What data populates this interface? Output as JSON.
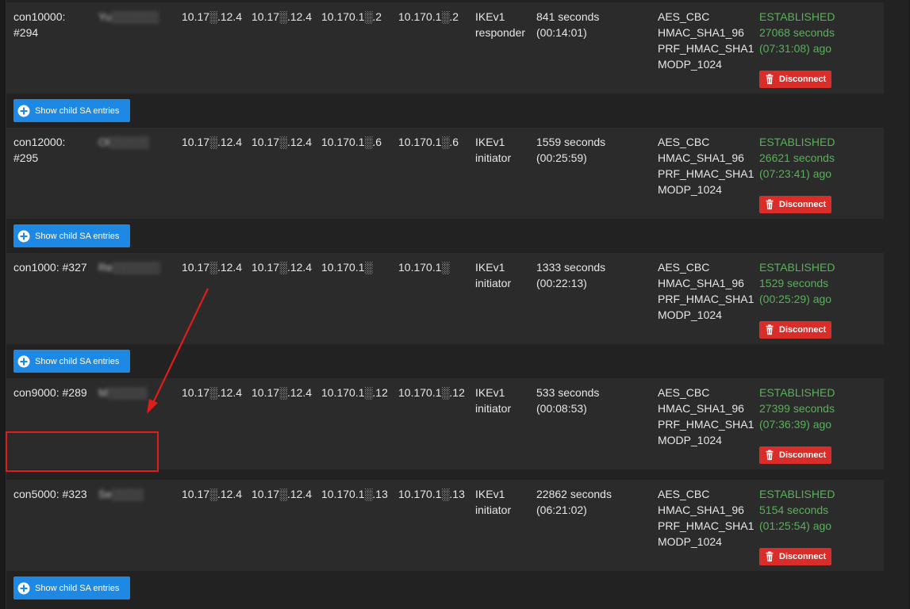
{
  "labels": {
    "disconnect": "Disconnect",
    "show_child": "Show child SA entries"
  },
  "colors": {
    "established": "#58b158",
    "disconnect_bg": "#d92d2a",
    "child_button_bg": "#1e88e5",
    "annotation": "#e21b1b"
  },
  "icons": {
    "disconnect": "trash-icon",
    "show_child": "plus-circle-icon"
  },
  "rows": [
    {
      "id_line1": "con10000:",
      "id_line2": "#294",
      "description": "Yu░░░░░░",
      "local_id": "10.17░.12.4",
      "remote_id": "10.17░.12.4",
      "local_ip": "10.170.1░.2",
      "remote_ip": "10.170.1░.2",
      "ike_line1": "IKEv1",
      "ike_line2": "responder",
      "life_line1": "841 seconds",
      "life_line2": "(00:14:01)",
      "algo": [
        "AES_CBC",
        "HMAC_SHA1_96",
        "PRF_HMAC_SHA1",
        "MODP_1024"
      ],
      "status_line1": "ESTABLISHED",
      "status_line2": "27068 seconds",
      "status_line3": "(07:31:08) ago"
    },
    {
      "id_line1": "con12000:",
      "id_line2": "#295",
      "description": "Ol░░░░░",
      "local_id": "10.17░.12.4",
      "remote_id": "10.17░.12.4",
      "local_ip": "10.170.1░.6",
      "remote_ip": "10.170.1░.6",
      "ike_line1": "IKEv1",
      "ike_line2": "initiator",
      "life_line1": "1559 seconds",
      "life_line2": "(00:25:59)",
      "algo": [
        "AES_CBC",
        "HMAC_SHA1_96",
        "PRF_HMAC_SHA1",
        "MODP_1024"
      ],
      "status_line1": "ESTABLISHED",
      "status_line2": "26621 seconds",
      "status_line3": "(07:23:41) ago"
    },
    {
      "id_line1": "con1000: #327",
      "id_line2": "",
      "description": "Re░░░░░░",
      "local_id": "10.17░.12.4",
      "remote_id": "10.17░.12.4",
      "local_ip": "10.170.1░",
      "remote_ip": "10.170.1░",
      "ike_line1": "IKEv1",
      "ike_line2": "initiator",
      "life_line1": "1333 seconds",
      "life_line2": "(00:22:13)",
      "algo": [
        "AES_CBC",
        "HMAC_SHA1_96",
        "PRF_HMAC_SHA1",
        "MODP_1024"
      ],
      "status_line1": "ESTABLISHED",
      "status_line2": "1529 seconds",
      "status_line3": "(00:25:29) ago"
    },
    {
      "id_line1": "con9000: #289",
      "id_line2": "",
      "description": "M░░░░░",
      "local_id": "10.17░.12.4",
      "remote_id": "10.17░.12.4",
      "local_ip": "10.170.1░.12",
      "remote_ip": "10.170.1░.12",
      "ike_line1": "IKEv1",
      "ike_line2": "initiator",
      "life_line1": "533 seconds",
      "life_line2": "(00:08:53)",
      "algo": [
        "AES_CBC",
        "HMAC_SHA1_96",
        "PRF_HMAC_SHA1",
        "MODP_1024"
      ],
      "status_line1": "ESTABLISHED",
      "status_line2": "27399 seconds",
      "status_line3": "(07:36:39) ago"
    },
    {
      "id_line1": "con5000: #323",
      "id_line2": "",
      "description": "Se░░░░",
      "local_id": "10.17░.12.4",
      "remote_id": "10.17░.12.4",
      "local_ip": "10.170.1░.13",
      "remote_ip": "10.170.1░.13",
      "ike_line1": "IKEv1",
      "ike_line2": "initiator",
      "life_line1": "22862 seconds",
      "life_line2": "(06:21:02)",
      "algo": [
        "AES_CBC",
        "HMAC_SHA1_96",
        "PRF_HMAC_SHA1",
        "MODP_1024"
      ],
      "status_line1": "ESTABLISHED",
      "status_line2": "5154 seconds",
      "status_line3": "(01:25:54) ago"
    }
  ]
}
